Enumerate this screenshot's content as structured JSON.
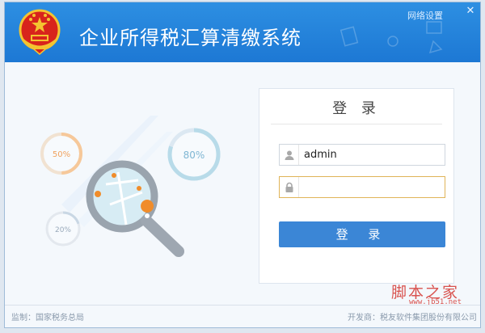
{
  "window": {
    "title": "企业所得税汇算清缴系统",
    "network_settings": "网络设置",
    "close_glyph": "✕"
  },
  "illustration": {
    "gauges": [
      "50%",
      "80%",
      "20%"
    ]
  },
  "login": {
    "title": "登 录",
    "username_value": "admin",
    "password_value": "",
    "button_label": "登 录"
  },
  "footer": {
    "supervisor": "监制：国家税务总局",
    "developer": "开发商：税友软件集团股份有限公司"
  },
  "watermark": {
    "text": "脚本之家",
    "url": "www.jb51.net"
  },
  "colors": {
    "header": "#2388dc",
    "login_button": "#3b86d6",
    "password_focus_border": "#e0b458"
  },
  "icons": [
    "national-emblem-icon",
    "user-icon",
    "lock-icon",
    "magnifier-icon",
    "location-pin-icon",
    "close-icon"
  ]
}
